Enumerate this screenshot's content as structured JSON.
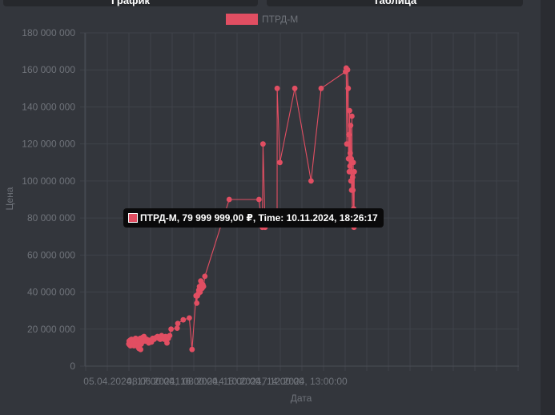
{
  "tabs": [
    {
      "label": "График"
    },
    {
      "label": "Таблица"
    }
  ],
  "colors": {
    "series": "#e14e62",
    "active_point": "#ff1a2e"
  },
  "tooltip": {
    "text": "ПТРД-М, 79 999 999,00 ₽, Time: 10.11.2024, 18:26:17"
  },
  "chart_data": {
    "type": "line",
    "legend": "top",
    "grid": true,
    "ylabel": "Цена",
    "xlabel": "Дата",
    "ylim": [
      0,
      180000000
    ],
    "y_ticks": [
      "180 000 000",
      "160 000 000",
      "140 000 000",
      "120 000 000",
      "100 000 000",
      "80 000 000",
      "60 000 000",
      "40 000 000",
      "20 000 000",
      "0"
    ],
    "x_ticks": [
      "05.04.2024, 17:00:00",
      "08.06.2024, 16:00:00",
      "11.08.2024, 15:00:00",
      "14.10.2024, 14:00:00",
      "17.12.2024, 13:00:00"
    ],
    "x_tick_dates": [
      "2024-04-05T17:00",
      "2024-06-08T16:00",
      "2024-08-11T15:00",
      "2024-10-14T14:00",
      "2024-12-17T13:00"
    ],
    "series": [
      {
        "name": "ПТРД-М",
        "points": [
          [
            "2024-04-05T12:00",
            12000000
          ],
          [
            "2024-04-06T00:00",
            13500000
          ],
          [
            "2024-04-06T12:00",
            11500000
          ],
          [
            "2024-04-07T00:00",
            12500000
          ],
          [
            "2024-04-07T12:00",
            14000000
          ],
          [
            "2024-04-08T00:00",
            11000000
          ],
          [
            "2024-04-08T12:00",
            13000000
          ],
          [
            "2024-04-09T00:00",
            12000000
          ],
          [
            "2024-04-09T12:00",
            14500000
          ],
          [
            "2024-04-10T00:00",
            12500000
          ],
          [
            "2024-04-10T12:00",
            11500000
          ],
          [
            "2024-04-11T00:00",
            13500000
          ],
          [
            "2024-04-11T12:00",
            12000000
          ],
          [
            "2024-04-12T00:00",
            14000000
          ],
          [
            "2024-04-12T12:00",
            13000000
          ],
          [
            "2024-04-13T00:00",
            11000000
          ],
          [
            "2024-04-13T12:00",
            12500000
          ],
          [
            "2024-04-14T00:00",
            14500000
          ],
          [
            "2024-04-14T12:00",
            13000000
          ],
          [
            "2024-04-15T00:00",
            12000000
          ],
          [
            "2024-04-15T12:00",
            15000000
          ],
          [
            "2024-04-16T00:00",
            13500000
          ],
          [
            "2024-04-17T00:00",
            12000000
          ],
          [
            "2024-04-17T12:00",
            14000000
          ],
          [
            "2024-04-18T00:00",
            11500000
          ],
          [
            "2024-04-18T12:00",
            13000000
          ],
          [
            "2024-04-19T00:00",
            10500000
          ],
          [
            "2024-04-19T12:00",
            14500000
          ],
          [
            "2024-04-20T00:00",
            12500000
          ],
          [
            "2024-04-20T12:00",
            9500000
          ],
          [
            "2024-04-21T00:00",
            14000000
          ],
          [
            "2024-04-21T12:00",
            11000000
          ],
          [
            "2024-04-22T00:00",
            13000000
          ],
          [
            "2024-04-22T12:00",
            15000000
          ],
          [
            "2024-04-23T00:00",
            9000000
          ],
          [
            "2024-04-23T12:00",
            13500000
          ],
          [
            "2024-04-24T00:00",
            12000000
          ],
          [
            "2024-04-24T12:00",
            14500000
          ],
          [
            "2024-04-25T00:00",
            13000000
          ],
          [
            "2024-04-26T00:00",
            15500000
          ],
          [
            "2024-04-27T00:00",
            14000000
          ],
          [
            "2024-04-28T00:00",
            16000000
          ],
          [
            "2024-04-29T00:00",
            14500000
          ],
          [
            "2024-04-30T00:00",
            13500000
          ],
          [
            "2024-05-02T00:00",
            14500000
          ],
          [
            "2024-05-05T00:00",
            12500000
          ],
          [
            "2024-05-07T00:00",
            14000000
          ],
          [
            "2024-05-09T00:00",
            13000000
          ],
          [
            "2024-05-11T00:00",
            15000000
          ],
          [
            "2024-05-13T00:00",
            14500000
          ],
          [
            "2024-05-16T00:00",
            15500000
          ],
          [
            "2024-05-18T00:00",
            16000000
          ],
          [
            "2024-05-20T00:00",
            15000000
          ],
          [
            "2024-05-22T00:00",
            14500000
          ],
          [
            "2024-05-24T00:00",
            16500000
          ],
          [
            "2024-05-26T00:00",
            15000000
          ],
          [
            "2024-05-28T00:00",
            14500000
          ],
          [
            "2024-05-30T00:00",
            16000000
          ],
          [
            "2024-06-01T00:00",
            12500000
          ],
          [
            "2024-06-03T00:00",
            15000000
          ],
          [
            "2024-06-05T00:00",
            16500000
          ],
          [
            "2024-06-07T00:00",
            20000000
          ],
          [
            "2024-06-16T00:00",
            20500000
          ],
          [
            "2024-06-17T00:00",
            23000000
          ],
          [
            "2024-06-25T00:00",
            25000000
          ],
          [
            "2024-07-04T00:00",
            26000000
          ],
          [
            "2024-07-08T00:00",
            9000000
          ],
          [
            "2024-07-14T00:00",
            38000000
          ],
          [
            "2024-07-15T00:00",
            34000000
          ],
          [
            "2024-07-16T00:00",
            38000000
          ],
          [
            "2024-07-17T00:00",
            39000000
          ],
          [
            "2024-07-18T00:00",
            41000000
          ],
          [
            "2024-07-19T00:00",
            43000000
          ],
          [
            "2024-07-20T00:00",
            40000000
          ],
          [
            "2024-07-21T00:00",
            46000000
          ],
          [
            "2024-07-22T00:00",
            44000000
          ],
          [
            "2024-07-23T00:00",
            42000000
          ],
          [
            "2024-07-24T00:00",
            44000000
          ],
          [
            "2024-07-25T00:00",
            43000000
          ],
          [
            "2024-07-27T00:00",
            48500000
          ],
          [
            "2024-09-01T00:00",
            90000000
          ],
          [
            "2024-10-15T00:00",
            90000000
          ],
          [
            "2024-10-20T00:00",
            75000000
          ],
          [
            "2024-10-21T00:00",
            120000000
          ],
          [
            "2024-10-24T00:00",
            75000000
          ],
          [
            "2024-11-10T18:26",
            79999999
          ],
          [
            "2024-11-11T00:00",
            150000000
          ],
          [
            "2024-11-15T00:00",
            110000000
          ],
          [
            "2024-12-07T00:00",
            150000000
          ],
          [
            "2024-12-31T00:00",
            100000000
          ],
          [
            "2025-01-15T00:00",
            150000000
          ],
          [
            "2025-02-20T00:00",
            159000000
          ],
          [
            "2025-02-21T00:00",
            161000000
          ],
          [
            "2025-02-22T00:00",
            120000000
          ],
          [
            "2025-02-23T00:00",
            160000000
          ],
          [
            "2025-02-24T00:00",
            150000000
          ],
          [
            "2025-02-24T12:00",
            112000000
          ],
          [
            "2025-02-25T00:00",
            125000000
          ],
          [
            "2025-02-25T12:00",
            105000000
          ],
          [
            "2025-02-26T00:00",
            138000000
          ],
          [
            "2025-02-26T12:00",
            108000000
          ],
          [
            "2025-02-27T00:00",
            115000000
          ],
          [
            "2025-02-27T12:00",
            130000000
          ],
          [
            "2025-02-28T00:00",
            100000000
          ],
          [
            "2025-02-28T12:00",
            112000000
          ],
          [
            "2025-03-01T00:00",
            95000000
          ],
          [
            "2025-03-01T12:00",
            135000000
          ],
          [
            "2025-03-02T00:00",
            78000000
          ],
          [
            "2025-03-02T12:00",
            102000000
          ],
          [
            "2025-03-03T00:00",
            95000000
          ],
          [
            "2025-03-03T12:00",
            110000000
          ],
          [
            "2025-03-04T00:00",
            85000000
          ],
          [
            "2025-03-04T12:00",
            75000000
          ],
          [
            "2025-03-05T00:00",
            105000000
          ]
        ]
      }
    ]
  }
}
